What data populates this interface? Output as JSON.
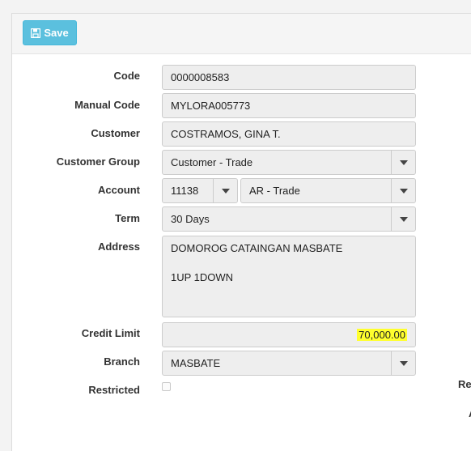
{
  "toolbar": {
    "save_label": "Save"
  },
  "form": {
    "code": {
      "label": "Code",
      "value": "0000008583"
    },
    "manual_code": {
      "label": "Manual Code",
      "value": "MYLORA005773"
    },
    "customer": {
      "label": "Customer",
      "value": "COSTRAMOS, GINA T."
    },
    "customer_group": {
      "label": "Customer Group",
      "value": "Customer - Trade"
    },
    "account": {
      "label": "Account",
      "code_value": "11138",
      "name_value": "AR - Trade"
    },
    "term": {
      "label": "Term",
      "value": "30 Days"
    },
    "address": {
      "label": "Address",
      "line1": "DOMOROG CATAINGAN MASBATE",
      "line2": "1UP 1DOWN"
    },
    "credit_limit": {
      "label": "Credit Limit",
      "value": "70,000.00",
      "highlight_color": "#ffff2e"
    },
    "branch": {
      "label": "Branch",
      "value": "MASBATE"
    },
    "restricted": {
      "label": "Restricted",
      "checked": false
    }
  },
  "right_column": {
    "cut_label_1": "Re",
    "cut_label_2": "A"
  },
  "colors": {
    "save_button": "#5bc0de",
    "field_bg": "#eeeeee",
    "panel_bg": "#ffffff"
  }
}
